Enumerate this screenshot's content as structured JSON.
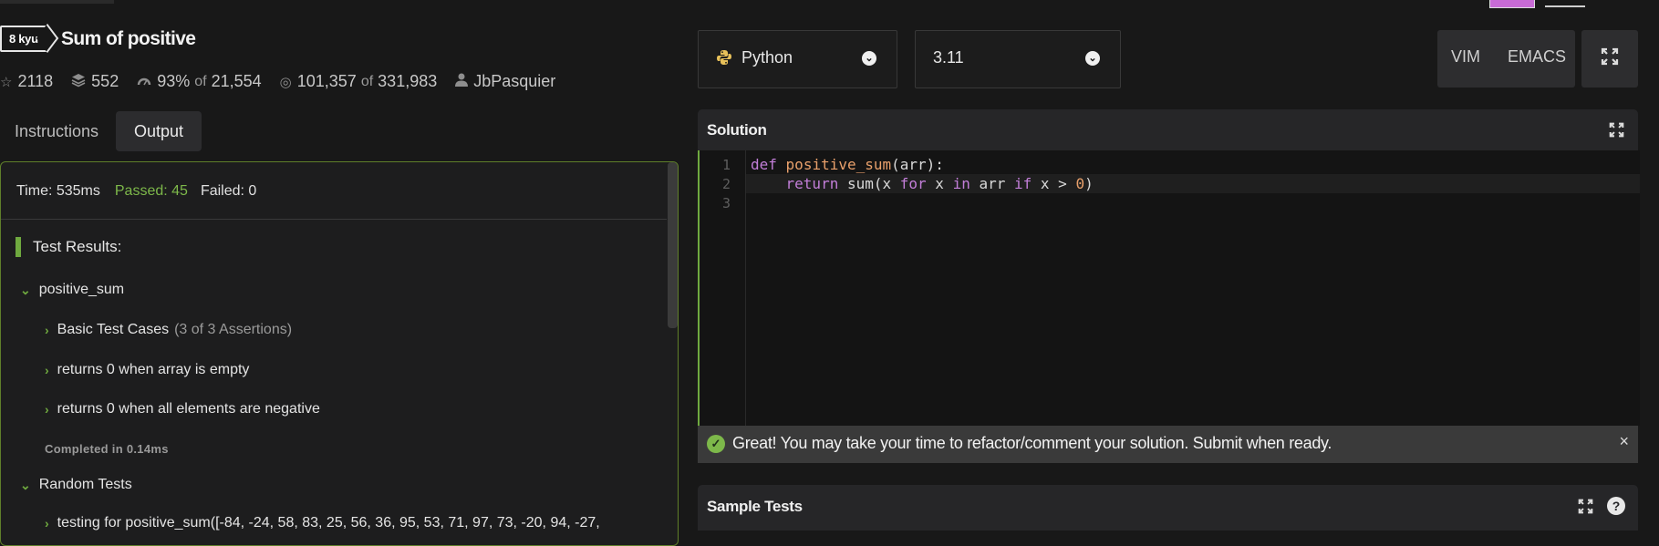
{
  "kata": {
    "rank": "8 kyu",
    "title": "Sum of positive",
    "stars": "2118",
    "collections": "552",
    "satisfaction_pct": "93%",
    "satisfaction_of": "of",
    "satisfaction_votes": "21,554",
    "completed": "101,357",
    "completed_of": "of",
    "attempts": "331,983",
    "author": "JbPasquier"
  },
  "tabs": {
    "instructions": "Instructions",
    "output": "Output"
  },
  "output": {
    "time": "Time: 535ms",
    "passed": "Passed: 45",
    "failed": "Failed: 0",
    "test_results_label": "Test Results:",
    "suite": "positive_sum",
    "basic": "Basic Test Cases",
    "basic_count": "(3 of 3 Assertions)",
    "test_empty": "returns 0 when array is empty",
    "test_negative": "returns 0 when all elements are negative",
    "completed": "Completed in 0.14ms",
    "random": "Random Tests",
    "random_test": "testing for positive_sum([-84, -24, 58, 83, 25, 56, 36, 95, 53, 71, 97, 73, -20, 94, -27,"
  },
  "toolbar": {
    "language": "Python",
    "version": "3.11",
    "vim": "VIM",
    "emacs": "EMACS"
  },
  "solution": {
    "label": "Solution",
    "line_numbers": [
      "1",
      "2",
      "3"
    ],
    "code": {
      "l1_def": "def",
      "l1_fn": "positive_sum",
      "l1_rest": "(arr):",
      "l2_return": "return",
      "l2_a": " sum(x ",
      "l2_for": "for",
      "l2_b": " x ",
      "l2_in": "in",
      "l2_c": " arr ",
      "l2_if": "if",
      "l2_d": " x > ",
      "l2_zero": "0",
      "l2_e": ")"
    }
  },
  "banner": {
    "message": "Great! You may take your time to refactor/comment your solution. Submit when ready.",
    "close": "×"
  },
  "sample_tests": {
    "label": "Sample Tests",
    "help": "?"
  },
  "colors": {
    "accent_green": "#6fa93f",
    "passed_green": "#7db84a",
    "keyword_purple": "#c27ed8",
    "function_orange": "#e8a06b"
  }
}
